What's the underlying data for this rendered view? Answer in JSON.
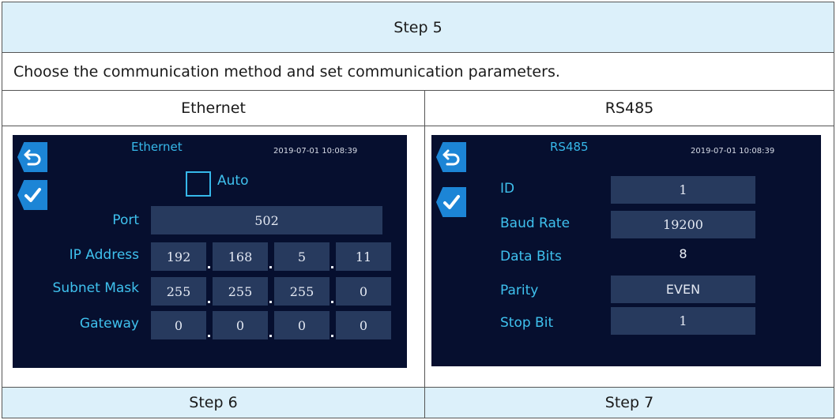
{
  "header": {
    "step_title": "Step 5"
  },
  "instruction": "Choose the communication method and set communication parameters.",
  "columns": {
    "left": "Ethernet",
    "right": "RS485"
  },
  "footer": {
    "left": "Step 6",
    "right": "Step 7"
  },
  "ethernet_screen": {
    "title": "Ethernet",
    "datetime": "2019-07-01 10:08:39",
    "auto_label": "Auto",
    "port_label": "Port",
    "port_value": "502",
    "ip_label": "IP Address",
    "ip": [
      "192",
      "168",
      "5",
      "11"
    ],
    "subnet_label": "Subnet Mask",
    "subnet": [
      "255",
      "255",
      "255",
      "0"
    ],
    "gateway_label": "Gateway",
    "gateway": [
      "0",
      "0",
      "0",
      "0"
    ]
  },
  "rs485_screen": {
    "title": "RS485",
    "datetime": "2019-07-01 10:08:39",
    "id_label": "ID",
    "id_value": "1",
    "baud_label": "Baud Rate",
    "baud_value": "19200",
    "databits_label": "Data Bits",
    "databits_value": "8",
    "parity_label": "Parity",
    "parity_value": "EVEN",
    "stopbit_label": "Stop Bit",
    "stopbit_value": "1"
  },
  "colors": {
    "header_bg": "#dcf0fa",
    "screen_bg": "#060f2f",
    "accent": "#36b8ea",
    "field_bg": "#273a5e",
    "button": "#1c85d6"
  }
}
